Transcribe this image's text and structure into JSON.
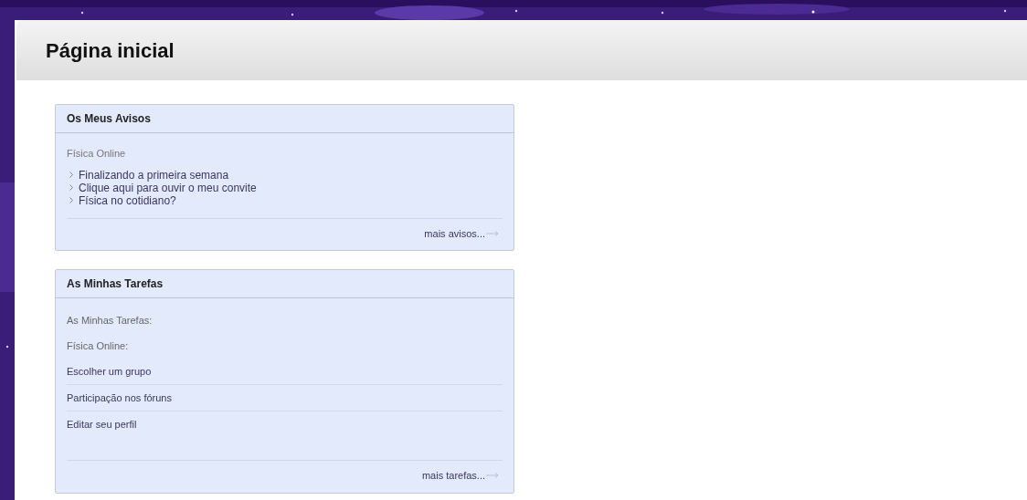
{
  "page_title": "Página inicial",
  "panels": [
    {
      "kind": "announcements",
      "title": "Os Meus Avisos",
      "course": "Física Online",
      "items": [
        "Finalizando a primeira semana",
        "Clique aqui para ouvir o meu convite",
        "Física no cotidiano?"
      ],
      "more_link": "mais avisos..."
    },
    {
      "kind": "tasks",
      "title": "As Minhas Tarefas",
      "labels": [
        "As Minhas Tarefas:",
        "Física Online:"
      ],
      "items": [
        "Escolher um grupo",
        "Participação nos fóruns",
        "Editar seu perfil"
      ],
      "more_link": "mais tarefas..."
    }
  ]
}
